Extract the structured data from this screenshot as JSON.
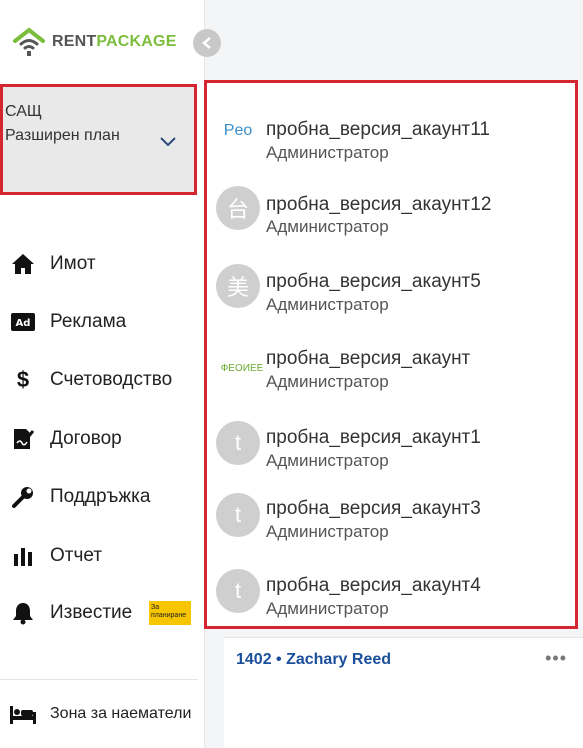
{
  "brand": {
    "name_part1": "RENT",
    "name_part2": "PACKAGE",
    "accent": "#7cbd3c"
  },
  "collapse_icon": "chevron-left-icon",
  "account_switch": {
    "region": "САЩ",
    "plan": "Разширен план"
  },
  "nav": [
    {
      "label": "Имот",
      "icon": "home-icon"
    },
    {
      "label": "Реклама",
      "icon": "ad-icon"
    },
    {
      "label": "Счетоводство",
      "icon": "dollar-icon"
    },
    {
      "label": "Договор",
      "icon": "contract-icon"
    },
    {
      "label": "Поддръжка",
      "icon": "wrench-icon"
    },
    {
      "label": "Отчет",
      "icon": "bar-chart-icon"
    },
    {
      "label": "Известие",
      "icon": "bell-icon",
      "badge": "За планиране"
    }
  ],
  "tenant_zone": {
    "label": "Зона за наематели",
    "icon": "bed-icon"
  },
  "card": {
    "title": "1402 • Zachary Reed",
    "more": "•••"
  },
  "accounts": [
    {
      "name": "пробна_версия_акаунт11",
      "role": "Администратор",
      "avatar": "Peo"
    },
    {
      "name": "пробна_версия_акаунт12",
      "role": "Администратор",
      "avatar": "台"
    },
    {
      "name": "пробна_версия_акаунт5",
      "role": "Администратор",
      "avatar": "美"
    },
    {
      "name": "пробна_версия_акаунт",
      "role": "Администратор",
      "avatar": "ФЕОИЕЕ"
    },
    {
      "name": "пробна_версия_акаунт1",
      "role": "Администратор",
      "avatar": "t"
    },
    {
      "name": "пробна_версия_акаунт3",
      "role": "Администратор",
      "avatar": "t"
    },
    {
      "name": "пробна_версия_акаунт4",
      "role": "Администратор",
      "avatar": "t"
    }
  ],
  "colors": {
    "highlight_border": "#d32630",
    "badge": "#f7c600",
    "link": "#1b4f9c"
  }
}
